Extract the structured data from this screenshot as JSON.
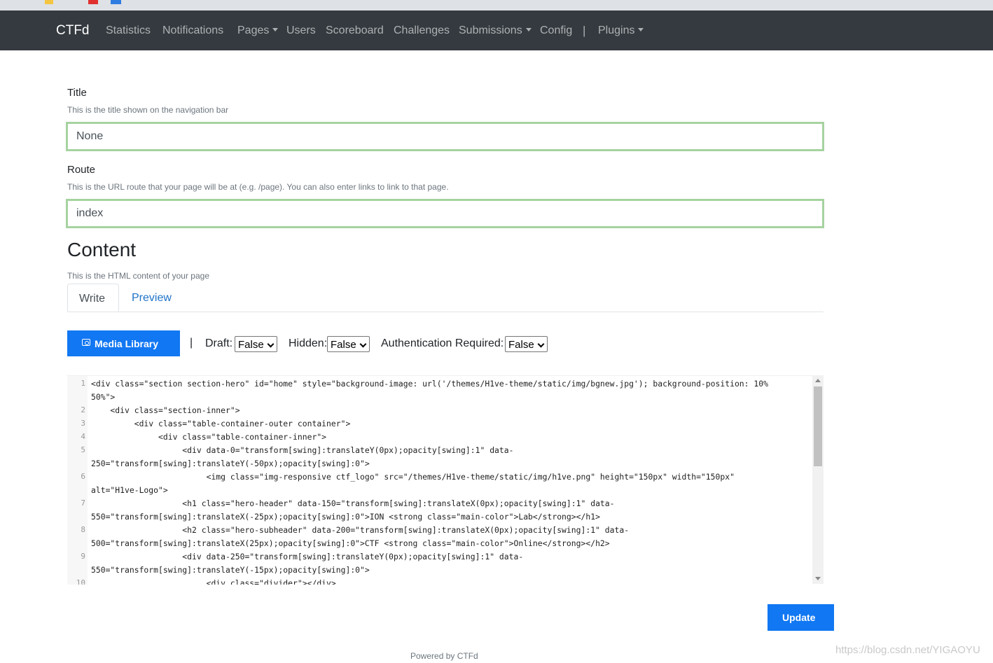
{
  "navbar": {
    "brand": "CTFd",
    "items": [
      {
        "label": "Statistics",
        "dropdown": false
      },
      {
        "label": "Notifications",
        "dropdown": false
      },
      {
        "label": "Pages",
        "dropdown": true
      },
      {
        "label": "Users",
        "dropdown": false
      },
      {
        "label": "Scoreboard",
        "dropdown": false
      },
      {
        "label": "Challenges",
        "dropdown": false
      },
      {
        "label": "Submissions",
        "dropdown": true
      },
      {
        "label": "Config",
        "dropdown": false
      }
    ],
    "separator": "|",
    "plugins": "Plugins"
  },
  "form": {
    "title_label": "Title",
    "title_help": "This is the title shown on the navigation bar",
    "title_value": "None",
    "route_label": "Route",
    "route_help": "This is the URL route that your page will be at (e.g. /page). You can also enter links to link to that page.",
    "route_value": "index",
    "content_heading": "Content",
    "content_help": "This is the HTML content of your page"
  },
  "tabs": {
    "write": "Write",
    "preview": "Preview"
  },
  "toolbar": {
    "media_library": "Media Library",
    "pipe": "|",
    "draft_label": "Draft:",
    "draft_value": "False",
    "hidden_label": "Hidden:",
    "hidden_value": "False",
    "auth_label": "Authentication Required:",
    "auth_value": "False"
  },
  "editor": {
    "lines": [
      {
        "n": "1",
        "text": "<div class=\"section section-hero\" id=\"home\" style=\"background-image: url('/themes/H1ve-theme/static/img/bgnew.jpg'); background-position: 10%"
      },
      {
        "n": "",
        "text": "50%\">"
      },
      {
        "n": "2",
        "text": "    <div class=\"section-inner\">"
      },
      {
        "n": "3",
        "text": "         <div class=\"table-container-outer container\">"
      },
      {
        "n": "4",
        "text": "              <div class=\"table-container-inner\">"
      },
      {
        "n": "5",
        "text": "                   <div data-0=\"transform[swing]:translateY(0px);opacity[swing]:1\" data-"
      },
      {
        "n": "",
        "text": "250=\"transform[swing]:translateY(-50px);opacity[swing]:0\">"
      },
      {
        "n": "6",
        "text": "                        <img class=\"img-responsive ctf_logo\" src=\"/themes/H1ve-theme/static/img/h1ve.png\" height=\"150px\" width=\"150px\""
      },
      {
        "n": "",
        "text": "alt=\"H1ve-Logo\">"
      },
      {
        "n": "7",
        "text": "                   <h1 class=\"hero-header\" data-150=\"transform[swing]:translateX(0px);opacity[swing]:1\" data-"
      },
      {
        "n": "",
        "text": "550=\"transform[swing]:translateX(-25px);opacity[swing]:0\">ION <strong class=\"main-color\">Lab</strong></h1>"
      },
      {
        "n": "8",
        "text": "                   <h2 class=\"hero-subheader\" data-200=\"transform[swing]:translateX(0px);opacity[swing]:1\" data-"
      },
      {
        "n": "",
        "text": "500=\"transform[swing]:translateX(25px);opacity[swing]:0\">CTF <strong class=\"main-color\">Online</strong></h2>"
      },
      {
        "n": "9",
        "text": "                   <div data-250=\"transform[swing]:translateY(0px);opacity[swing]:1\" data-"
      },
      {
        "n": "",
        "text": "550=\"transform[swing]:translateY(-15px);opacity[swing]:0\">"
      },
      {
        "n": "10",
        "text": "                        <div class=\"divider\"></div>"
      }
    ]
  },
  "actions": {
    "update": "Update"
  },
  "footer": {
    "powered": "Powered by CTFd"
  },
  "watermark": "https://blog.csdn.net/YIGAOYU",
  "colors": {
    "navbar": "#343a40",
    "primary": "#1177f2",
    "valid_border": "#a6d3a0",
    "tab_link": "#1f73c8"
  }
}
